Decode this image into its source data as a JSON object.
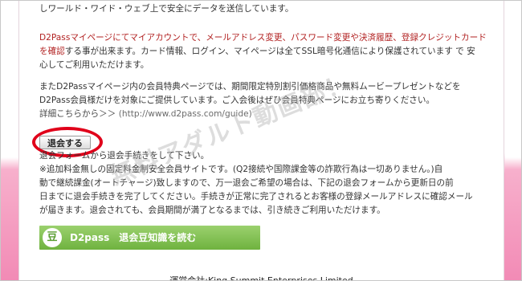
{
  "intro_tail": "しワールド・ワイド・ウェブ上で安全にデータを送信しています。",
  "mypage_notice": {
    "line1": "D2Passマイページにてマイアカウントで、メールアドレス変更、パスワード変更や決済履歴、登録クレジットカード",
    "line2_red": "を確認",
    "line2_rest": "する事が出来ます。カード情報、ログイン、マイページは全てSSL暗号化通信により保護されています で 安",
    "line3": "心してご利用いただけます。"
  },
  "benefits": {
    "line1": "またD2Passマイページ内の会員特典ページでは、期間限定特別割引価格商品や無料ムービープレゼントなどを",
    "line2": "D2Pass会員様だけを対象にご提供しています。ご入会後はぜひ会員特典ページにお立ち寄りください。",
    "details_link": "詳細こちらから＞＞",
    "url": "(http://www.d2pass.com/guide)"
  },
  "leave_button": "退会する",
  "leave_notes": {
    "line1": "退会フォームから退会手続きをして下さい。",
    "line2": "※追加料金無しの固定料金制安全会員サイトです。(Q2接続や国際課金等の詐欺行為は一切ありません。)自",
    "line3": "動で継続課金(オートチャージ)致しますので、万一退会ご希望の場合は、下記の退会フォームから更新日の前",
    "line4": "日までに退会手続きを完了してください。手続きが正常に完了されるとお客様の登録メールアドレスに確認メール",
    "line5": "が届きます。退会されても、会員期間が満了となるまでは、引き続きご利用いただけます。"
  },
  "banner": {
    "icon_char": "豆",
    "label": "D2pass　退会豆知識を読む"
  },
  "watermark": "無料アダルト動画部！",
  "footer": "運営会社:King Summit Enterprises Limited",
  "colors": {
    "accent_red": "#b22222",
    "banner_green": "#7cbf4a",
    "circle_red": "#e0001a",
    "side_pink": "#f48fb8"
  }
}
